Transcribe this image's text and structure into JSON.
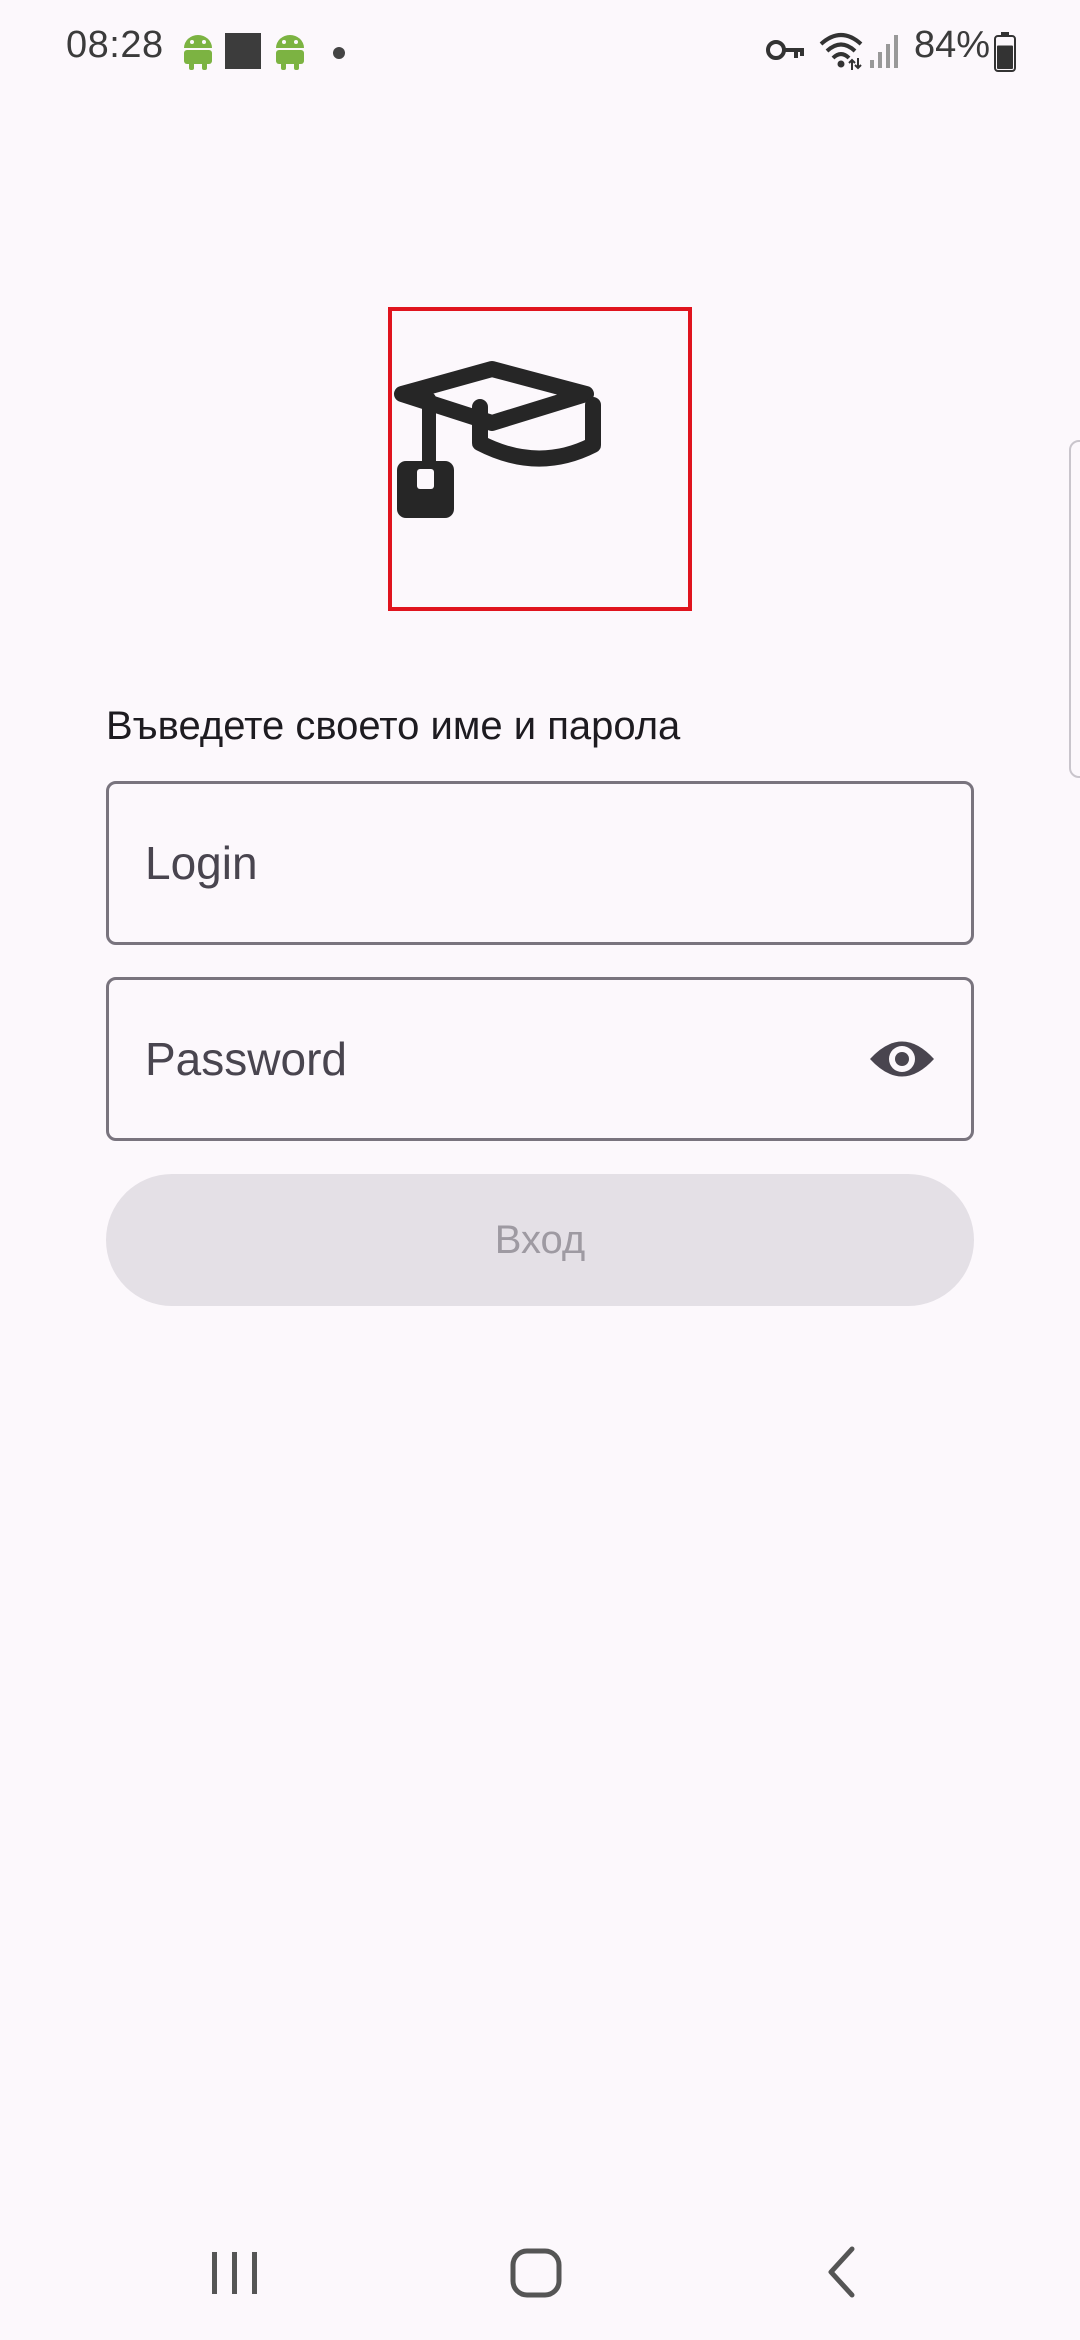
{
  "status_bar": {
    "time": "08:28",
    "battery_percent": "84%",
    "battery_level": 0.84,
    "icons": [
      "android-icon",
      "app-square-icon",
      "android-icon",
      "notification-dot-icon",
      "vpn-key-icon",
      "wifi-icon",
      "signal-icon",
      "battery-icon"
    ]
  },
  "logo": {
    "icon": "graduation-cap-icon",
    "frame_color": "#e0141e"
  },
  "login_form": {
    "prompt": "Въведете своето име и парола",
    "login_placeholder": "Login",
    "password_placeholder": "Password",
    "password_toggle_icon": "eye-icon",
    "submit_label": "Вход",
    "submit_enabled": false
  },
  "nav_bar": {
    "recents_icon": "recents-icon",
    "home_icon": "home-icon",
    "back_icon": "back-icon"
  },
  "colors": {
    "background": "#fcf8fc",
    "outline": "#79747e",
    "disabled_button": "#e4e0e6",
    "disabled_text": "#9e9aa2",
    "android_green": "#7cb342"
  }
}
